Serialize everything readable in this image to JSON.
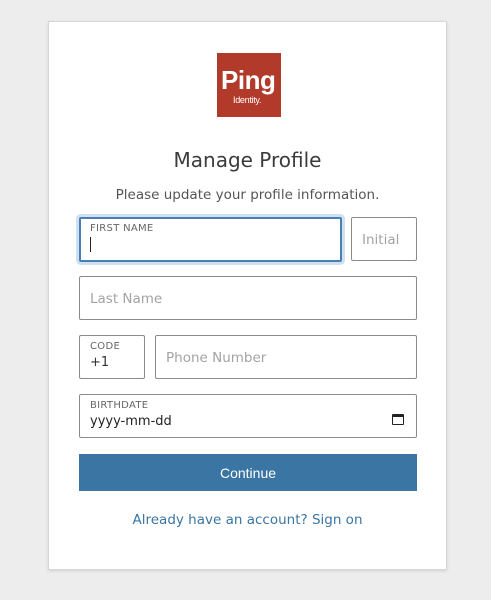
{
  "logo": {
    "main": "Ping",
    "sub": "Identity."
  },
  "title": "Manage Profile",
  "subtitle": "Please update your profile information.",
  "fields": {
    "first_name": {
      "label": "FIRST NAME",
      "value": ""
    },
    "initial": {
      "placeholder": "Initial"
    },
    "last_name": {
      "placeholder": "Last Name"
    },
    "code": {
      "label": "CODE",
      "value": "+1"
    },
    "phone": {
      "placeholder": "Phone Number"
    },
    "birthdate": {
      "label": "BIRTHDATE",
      "value": "yyyy-mm-dd"
    }
  },
  "continue_label": "Continue",
  "signon_link": "Already have an account? Sign on",
  "colors": {
    "brand": "#b23a2a",
    "primary": "#3a75a3",
    "focus": "#4a7fb5"
  },
  "icons": {
    "birthdate_picker": "calendar-icon"
  }
}
